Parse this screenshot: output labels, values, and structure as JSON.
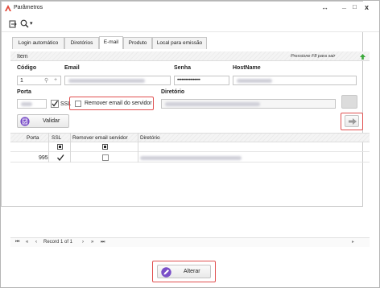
{
  "window": {
    "title": "Parâmetros",
    "restore_glyph": "↔",
    "minimize_glyph": "_",
    "maximize_glyph": "□",
    "close_glyph": "x"
  },
  "toolbar": {
    "icons": [
      "exit-icon",
      "search-icon"
    ],
    "search_dropdown_glyph": "▾"
  },
  "tabs": [
    {
      "label": "Login automático",
      "active": false
    },
    {
      "label": "Diretórios",
      "active": false
    },
    {
      "label": "E-mail",
      "active": true
    },
    {
      "label": "Produto",
      "active": false
    },
    {
      "label": "Local para emissão",
      "active": false
    }
  ],
  "section": {
    "title": "Item",
    "hint": "Pressione F8 para sair"
  },
  "form": {
    "codigo_label": "Código",
    "codigo_value": "1",
    "email_label": "Email",
    "senha_label": "Senha",
    "senha_value": "••••••••••••••••",
    "hostname_label": "HostName",
    "porta_label": "Porta",
    "ssl_label": "SSL",
    "ssl_checked": true,
    "remover_label": "Remover email do servidor",
    "remover_checked": false,
    "diretorio_label": "Diretório"
  },
  "validar_button": {
    "label": "Validar"
  },
  "grid": {
    "columns": [
      "Porta",
      "SSL",
      "Remover email servidor",
      "Diretório"
    ],
    "rows": [
      {
        "porta": "995",
        "ssl": true,
        "remover": false
      }
    ]
  },
  "navigator": {
    "record_text": "Record 1 of 1",
    "first": "⏮",
    "prev_page": "«",
    "prev": "‹",
    "next": "›",
    "next_page": "»",
    "last": "⏭"
  },
  "alterar_button": {
    "label": "Alterar"
  },
  "colors": {
    "accent_red": "#e05050",
    "purple": "#7a4fc8",
    "green_arrow": "#3aa83a"
  }
}
